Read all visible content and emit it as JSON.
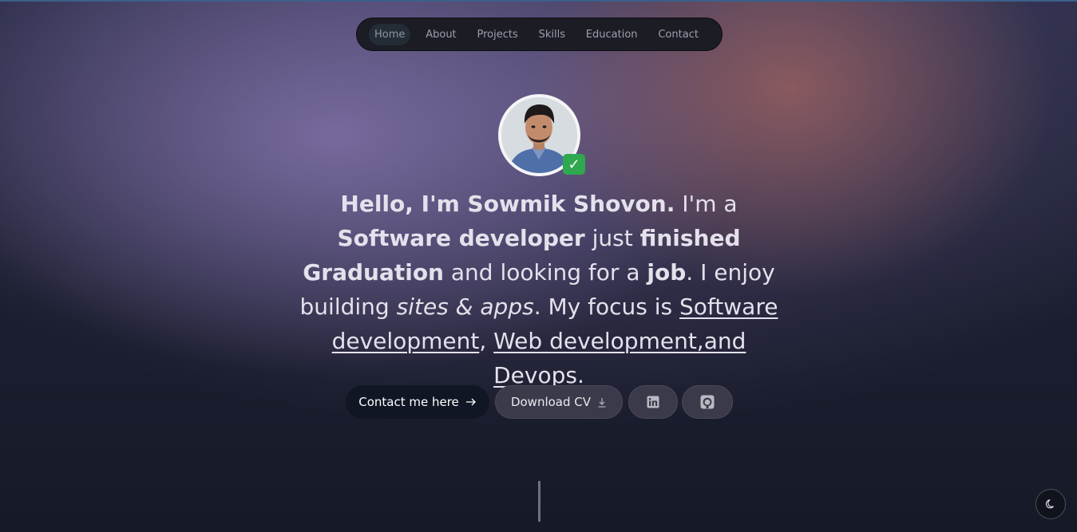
{
  "nav": {
    "items": [
      {
        "label": "Home",
        "active": true
      },
      {
        "label": "About"
      },
      {
        "label": "Projects"
      },
      {
        "label": "Skills"
      },
      {
        "label": "Education"
      },
      {
        "label": "Contact"
      }
    ]
  },
  "hero": {
    "badge_icon": "check-mark-emoji",
    "intro": {
      "hello": "Hello, I'm Sowmik Shovon.",
      "im_a": " I'm a ",
      "role": "Software developer",
      "just": " just ",
      "finished": "finished Graduation",
      "looking": " and looking for a ",
      "job": "job",
      "enjoy": ". I enjoy building ",
      "sites": "sites & apps",
      "focus": ". My focus is ",
      "focus1": "Software development",
      "comma": ", ",
      "focus2": "Web development,and Devops",
      "period": "."
    }
  },
  "actions": {
    "contact_label": "Contact me here",
    "contact_icon": "arrow-right-icon",
    "cv_label": "Download CV",
    "cv_icon": "download-icon",
    "linkedin_icon": "linkedin-icon",
    "github_icon": "github-icon"
  },
  "theme_toggle_icon": "moon-icon",
  "colors": {
    "background": "#1b1e2f",
    "accent_purple": "#7a6ca0",
    "accent_rose": "#965f5f",
    "primary_button": "#111625",
    "secondary_button": "#3a3a4a"
  }
}
